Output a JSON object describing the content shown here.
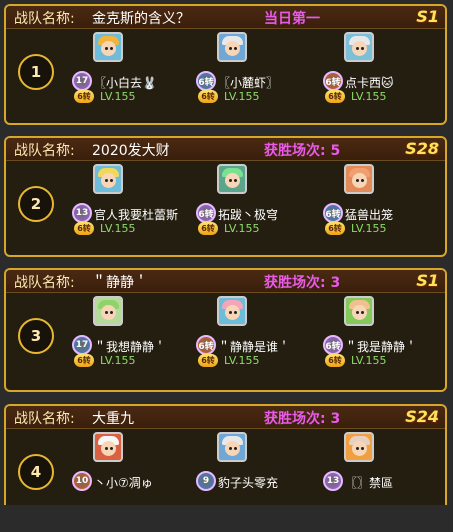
{
  "teams": [
    {
      "rank": "1",
      "label": "战队名称:",
      "name": "金克斯的含义？",
      "status": "当日第一",
      "season": "S1",
      "members": [
        {
          "name": "〖小白去🐰",
          "badge": "17",
          "badge_color": "#9a62e0",
          "vip": "6转",
          "level": "LV.155",
          "hair": "#f2b43a",
          "bg": "#6dbcd9"
        },
        {
          "name": "〖小麓虾〗",
          "badge": "6转",
          "badge_color": "#3b7fd1",
          "vip": "6转",
          "level": "LV.155",
          "hair": "#e8e8e8",
          "bg": "#6fa7d6"
        },
        {
          "name": "点卡西🐱",
          "badge": "6转",
          "badge_color": "#d65a1f",
          "vip": "6转",
          "level": "LV.155",
          "hair": "#e8e8e8",
          "bg": "#7cc0d8"
        }
      ]
    },
    {
      "rank": "2",
      "label": "战队名称:",
      "name": "2020发大财",
      "status": "获胜场次: 5",
      "season": "S28",
      "members": [
        {
          "name": "官人我要杜蕾斯",
          "badge": "13",
          "badge_color": "#9a62e0",
          "vip": "6转",
          "level": "LV.155",
          "hair": "#f2d85a",
          "bg": "#6dbcd9"
        },
        {
          "name": "拓跋丶极穹",
          "badge": "6转",
          "badge_color": "#9a62e0",
          "vip": "6转",
          "level": "LV.155",
          "hair": "#7be08f",
          "bg": "#5aa58c"
        },
        {
          "name": "猛兽出笼",
          "badge": "6转",
          "badge_color": "#3b7fd1",
          "vip": "6转",
          "level": "LV.155",
          "hair": "#f0a070",
          "bg": "#e28a5a"
        }
      ]
    },
    {
      "rank": "3",
      "label": "战队名称:",
      "name": "＂静静＇",
      "status": "获胜场次: 3",
      "season": "S1",
      "members": [
        {
          "name": "＂我想静静＇",
          "badge": "17",
          "badge_color": "#3b7fd1",
          "vip": "6转",
          "level": "LV.155",
          "hair": "#8fd46a",
          "bg": "#b6d99c"
        },
        {
          "name": "＂静静是谁＇",
          "badge": "6转",
          "badge_color": "#d65a1f",
          "vip": "6转",
          "level": "LV.155",
          "hair": "#f4a6b8",
          "bg": "#6dbcd9"
        },
        {
          "name": "＂我是静静＇",
          "badge": "6转",
          "badge_color": "#9a62e0",
          "vip": "6转",
          "level": "LV.155",
          "hair": "#f0c090",
          "bg": "#84c95a"
        }
      ]
    },
    {
      "rank": "4",
      "label": "战队名称:",
      "name": "大重九",
      "status": "获胜场次: 3",
      "season": "S24",
      "members": [
        {
          "name": "丶小⑦凋ゅ",
          "badge": "10",
          "badge_color": "#d65a1f",
          "vip": "",
          "level": "",
          "hair": "#f7f7f7",
          "bg": "#d96040"
        },
        {
          "name": "豹子头零充",
          "badge": "9",
          "badge_color": "#3b7fd1",
          "vip": "",
          "level": "",
          "hair": "#e8e8e8",
          "bg": "#6fa7d6"
        },
        {
          "name": "〖〗禁區",
          "badge": "13",
          "badge_color": "#9a62e0",
          "vip": "",
          "level": "",
          "hair": "#e8d0c0",
          "bg": "#f0a040"
        }
      ]
    }
  ]
}
